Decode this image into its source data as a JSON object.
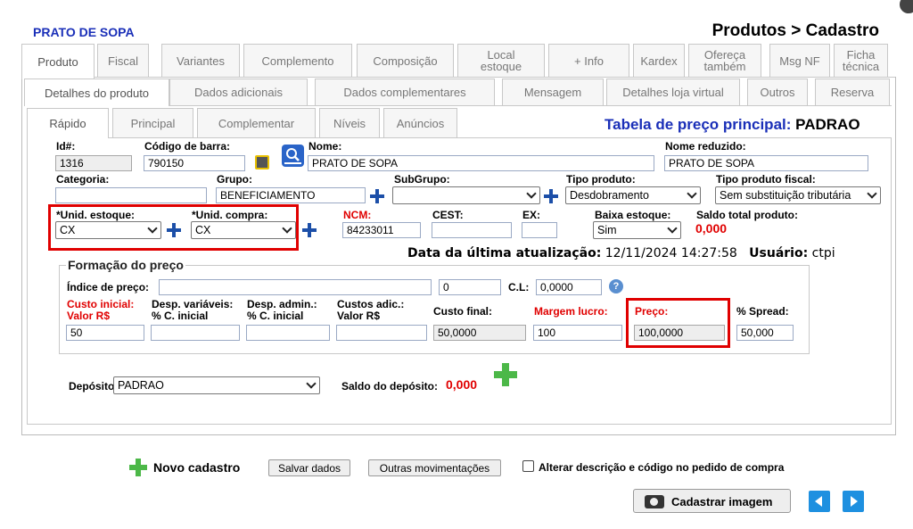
{
  "header": {
    "product_name": "PRATO DE SOPA",
    "breadcrumb": "Produtos > Cadastro"
  },
  "tabs_row1": [
    "Produto",
    "Fiscal",
    "Variantes",
    "Complemento",
    "Composição",
    "Local estoque",
    "+ Info",
    "Kardex",
    "Ofereça também",
    "Msg NF",
    "Ficha técnica"
  ],
  "tabs_row2": [
    "Detalhes do produto",
    "Dados adicionais",
    "Dados complementares",
    "Mensagem",
    "Detalhes loja virtual",
    "Outros",
    "Reserva"
  ],
  "tabs_row3": [
    "Rápido",
    "Principal",
    "Complementar",
    "Níveis",
    "Anúncios"
  ],
  "price_table": {
    "label": "Tabela de preço principal: ",
    "value": "PADRAO"
  },
  "form": {
    "id_label": "Id#:",
    "id_value": "1316",
    "barcode_label": "Código de barra:",
    "barcode_value": "790150",
    "name_label": "Nome:",
    "name_value": "PRATO DE SOPA",
    "short_name_label": "Nome reduzido:",
    "short_name_value": "PRATO DE SOPA",
    "category_label": "Categoria:",
    "category_value": "",
    "group_label": "Grupo:",
    "group_value": "BENEFICIAMENTO",
    "subgroup_label": "SubGrupo:",
    "subgroup_value": "",
    "product_type_label": "Tipo produto:",
    "product_type_value": "Desdobramento",
    "fiscal_type_label": "Tipo produto fiscal:",
    "fiscal_type_value": "Sem substituição tributária",
    "stock_unit_label": "*Unid. estoque:",
    "stock_unit_value": "CX",
    "purchase_unit_label": "*Unid. compra:",
    "purchase_unit_value": "CX",
    "ncm_label": "NCM:",
    "ncm_value": "84233011",
    "cest_label": "CEST:",
    "cest_value": "",
    "ex_label": "EX:",
    "ex_value": "",
    "low_stock_label": "Baixa estoque:",
    "low_stock_value": "Sim",
    "total_balance_label": "Saldo total produto:",
    "total_balance_value": "0,000",
    "last_update_label": "Data da última atualização:",
    "last_update_value": "12/11/2024 14:27:58",
    "user_label": "Usuário:",
    "user_value": "ctpi"
  },
  "pricing": {
    "legend": "Formação do preço",
    "index_label": "Índice de preço:",
    "index_value": "",
    "index_number": "0",
    "cl_label": "C.L:",
    "cl_value": "0,0000",
    "initial_cost_label1": "Custo inicial:",
    "initial_cost_label2": "Valor R$",
    "initial_cost_value": "50",
    "var_exp_label1": "Desp. variáveis:",
    "var_exp_label2": "% C. inicial",
    "var_exp_value": "",
    "adm_exp_label1": "Desp. admin.:",
    "adm_exp_label2": "% C. inicial",
    "adm_exp_value": "",
    "add_cost_label1": "Custos adic.:",
    "add_cost_label2": "Valor R$",
    "add_cost_value": "",
    "final_cost_label": "Custo final:",
    "final_cost_value": "50,0000",
    "margin_label": "Margem lucro:",
    "margin_value": "100",
    "price_label": "Preço:",
    "price_value": "100,0000",
    "spread_label": "% Spread:",
    "spread_value": "50,000"
  },
  "deposit": {
    "label": "Depósito:",
    "value": "PADRAO",
    "balance_label": "Saldo do depósito:",
    "balance_value": "0,000"
  },
  "footer": {
    "new_label": "Novo cadastro",
    "save_label": "Salvar dados",
    "other_label": "Outras movimentações",
    "alter_label": "Alterar descrição e código no pedido de compra",
    "image_label": "Cadastrar imagem"
  },
  "colors": {
    "accent_blue": "#1a2fb8",
    "red": "#e00000",
    "green": "#4cb848",
    "nav_blue": "#1e90e0"
  }
}
